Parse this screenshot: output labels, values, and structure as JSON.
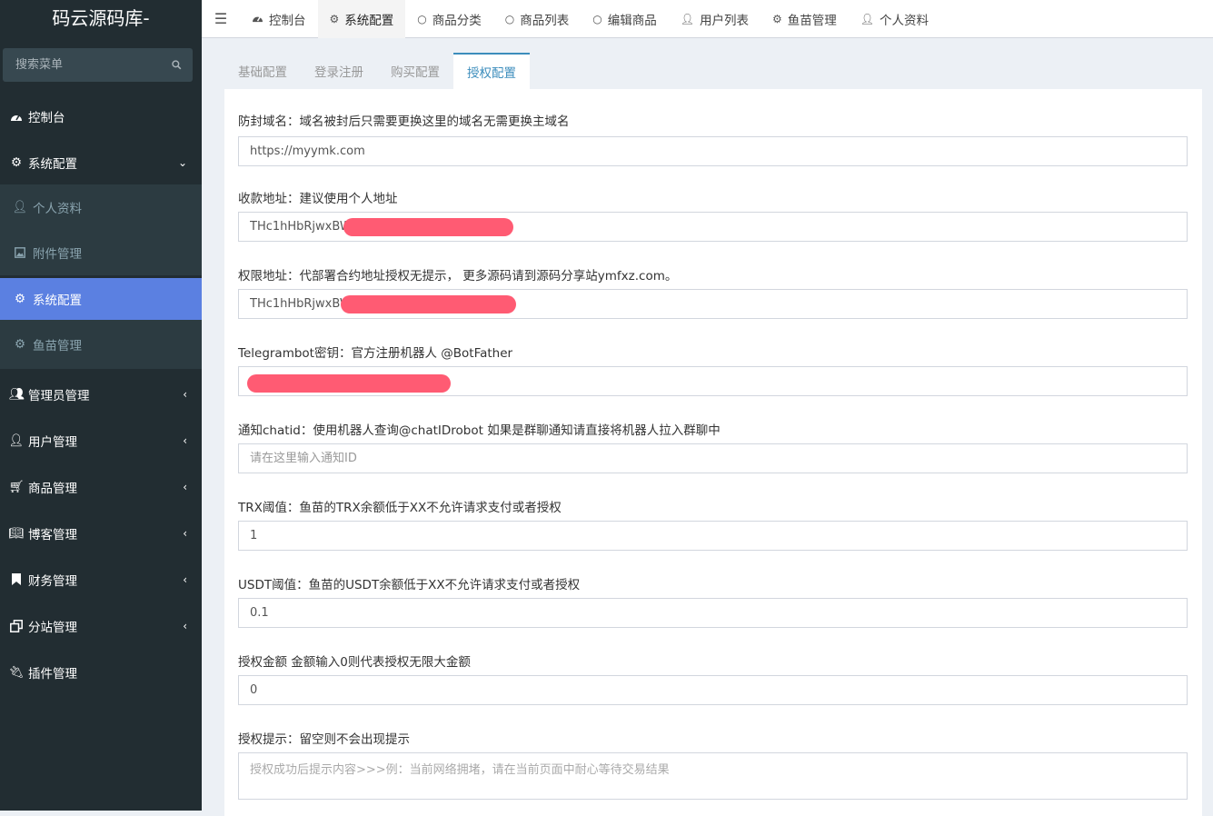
{
  "app": {
    "brand": "码云源码库-"
  },
  "sidebar": {
    "search_placeholder": "搜索菜单",
    "items": [
      {
        "label": "控制台",
        "icon": "dashboard-icon"
      },
      {
        "label": "系统配置",
        "icon": "cogs-icon",
        "expanded": true
      },
      {
        "label": "个人资料",
        "icon": "user-icon",
        "sub": true
      },
      {
        "label": "附件管理",
        "icon": "image-icon",
        "sub": true
      },
      {
        "label": "系统配置",
        "icon": "gear-icon",
        "sub": true,
        "active": true
      },
      {
        "label": "鱼苗管理",
        "icon": "gear-icon",
        "sub": true
      },
      {
        "label": "管理员管理",
        "icon": "users-icon"
      },
      {
        "label": "用户管理",
        "icon": "user-icon"
      },
      {
        "label": "商品管理",
        "icon": "cart-icon"
      },
      {
        "label": "博客管理",
        "icon": "book-icon"
      },
      {
        "label": "财务管理",
        "icon": "bookmark-icon"
      },
      {
        "label": "分站管理",
        "icon": "clone-icon"
      },
      {
        "label": "插件管理",
        "icon": "plug-icon"
      }
    ]
  },
  "topnav": {
    "tabs": [
      {
        "label": "控制台",
        "icon": "dashboard-icon"
      },
      {
        "label": "系统配置",
        "icon": "gear-icon",
        "active": true
      },
      {
        "label": "商品分类",
        "icon": "circle-icon"
      },
      {
        "label": "商品列表",
        "icon": "circle-icon"
      },
      {
        "label": "编辑商品",
        "icon": "circle-icon"
      },
      {
        "label": "用户列表",
        "icon": "person-icon"
      },
      {
        "label": "鱼苗管理",
        "icon": "gear-icon"
      },
      {
        "label": "个人资料",
        "icon": "user-icon"
      }
    ]
  },
  "config_tabs": [
    {
      "label": "基础配置"
    },
    {
      "label": "登录注册"
    },
    {
      "label": "购买配置"
    },
    {
      "label": "授权配置",
      "active": true
    }
  ],
  "form": {
    "domain": {
      "label": "防封域名：域名被封后只需要更换这里的域名无需更换主域名",
      "value": "https://myymk.com"
    },
    "pay_address": {
      "label": "收款地址：建议使用个人地址",
      "value": "THc1hHbRjwxBW"
    },
    "auth_address": {
      "label": "权限地址：代部署合约地址授权无提示， 更多源码请到源码分享站ymfxz.com。",
      "value": "THc1hHbRjwxBW"
    },
    "bot_key": {
      "label": "Telegrambot密钥：官方注册机器人 @BotFather",
      "value": ""
    },
    "chat_id": {
      "label": "通知chatid：使用机器人查询@chatIDrobot 如果是群聊通知请直接将机器人拉入群聊中",
      "placeholder": "请在这里输入通知ID",
      "value": ""
    },
    "trx_threshold": {
      "label": "TRX阈值：鱼苗的TRX余额低于XX不允许请求支付或者授权",
      "value": "1"
    },
    "usdt_threshold": {
      "label": "USDT阈值：鱼苗的USDT余额低于XX不允许请求支付或者授权",
      "value": "0.1"
    },
    "auth_amount": {
      "label": "授权金额 金额输入0则代表授权无限大金额",
      "value": "0"
    },
    "auth_tip": {
      "label": "授权提示：留空则不会出现提示",
      "placeholder": "授权成功后提示内容>>>例：当前网络拥堵，请在当前页面中耐心等待交易结果"
    }
  },
  "colors": {
    "sidebar_bg": "#222d32",
    "sidebar_active": "#5b80e1",
    "tab_accent": "#3c8dbc",
    "redaction": "#ff5b73"
  }
}
